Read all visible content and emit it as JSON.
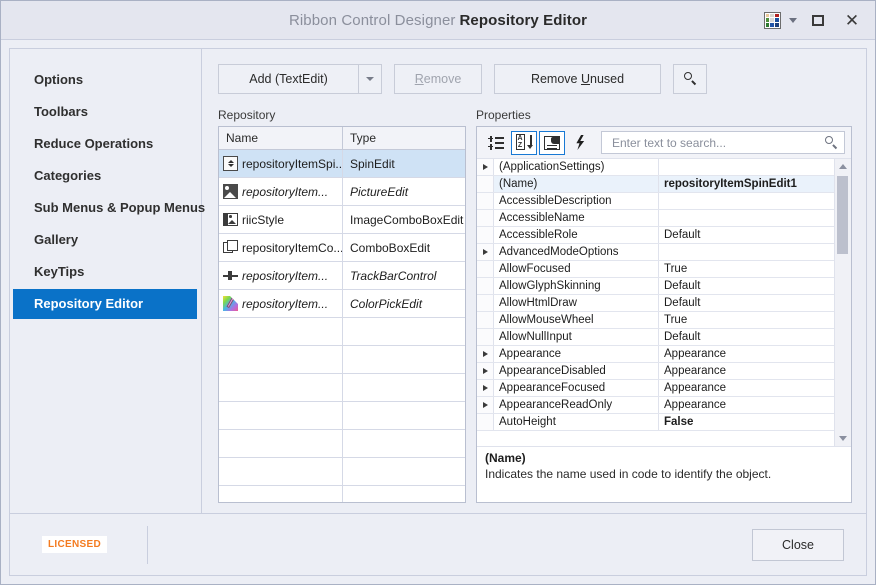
{
  "titlebar": {
    "app_name": "Ribbon Control Designer",
    "page_name": "Repository Editor",
    "skin_icon": "palette-grid-icon",
    "skin_caret_icon": "chevron-down-icon",
    "restore_icon": "restore-window-icon",
    "close_icon": "close-window-icon",
    "palette_colors": [
      "#e8c79a",
      "#d6d6cf",
      "#b02020",
      "#4f8f3d",
      "#d8d8d8",
      "#1b4f9c",
      "#2f7a32",
      "#2255a8",
      "#1c3f7a"
    ]
  },
  "sidebar": {
    "items": [
      {
        "label": "Options",
        "selected": false
      },
      {
        "label": "Toolbars",
        "selected": false
      },
      {
        "label": "Reduce Operations",
        "selected": false
      },
      {
        "label": "Categories",
        "selected": false
      },
      {
        "label": "Sub Menus & Popup Menus",
        "selected": false
      },
      {
        "label": "Gallery",
        "selected": false
      },
      {
        "label": "KeyTips",
        "selected": false
      },
      {
        "label": "Repository Editor",
        "selected": true
      }
    ],
    "selected_color": "#0a72c8"
  },
  "toolbar": {
    "add_label": "Add (TextEdit)",
    "add_dropdown_icon": "chevron-down-icon",
    "remove_label": "Remove",
    "remove_accesskey": "R",
    "remove_enabled": false,
    "remove_unused_label": "Remove Unused",
    "remove_unused_accesskey": "U",
    "search_icon": "search-icon"
  },
  "repository": {
    "label": "Repository",
    "columns": [
      "Name",
      "Type"
    ],
    "rows": [
      {
        "name": "repositoryItemSpi...",
        "type": "SpinEdit",
        "icon": "spin-edit-icon",
        "selected": true,
        "unused": false
      },
      {
        "name": "repositoryItem...",
        "type": "PictureEdit",
        "icon": "picture-edit-icon",
        "selected": false,
        "unused": true
      },
      {
        "name": "riicStyle",
        "type": "ImageComboBoxEdit",
        "icon": "image-combobox-edit-icon",
        "selected": false,
        "unused": false
      },
      {
        "name": "repositoryItemCo...",
        "type": "ComboBoxEdit",
        "icon": "combobox-edit-icon",
        "selected": false,
        "unused": false
      },
      {
        "name": "repositoryItem...",
        "type": "TrackBarControl",
        "icon": "trackbar-control-icon",
        "selected": false,
        "unused": true
      },
      {
        "name": "repositoryItem...",
        "type": "ColorPickEdit",
        "icon": "colorpick-edit-icon",
        "selected": false,
        "unused": true
      }
    ],
    "empty_row_count": 7,
    "selection_color": "#cfe2f5"
  },
  "properties": {
    "label": "Properties",
    "toolbar": {
      "categorized_icon": "categorized-sort-icon",
      "alphabetical_icon": "alphabetical-sort-icon",
      "alphabetical_active": true,
      "properties_icon": "properties-page-icon",
      "properties_active": true,
      "events_icon": "events-lightning-icon",
      "search_placeholder": "Enter text to search...",
      "search_value": "",
      "search_icon": "search-icon"
    },
    "rows": [
      {
        "name": "(ApplicationSettings)",
        "value": "",
        "expandable": true,
        "selected": false,
        "bold": false
      },
      {
        "name": "(Name)",
        "value": "repositoryItemSpinEdit1",
        "expandable": false,
        "selected": true,
        "bold": true
      },
      {
        "name": "AccessibleDescription",
        "value": "",
        "expandable": false,
        "selected": false,
        "bold": false
      },
      {
        "name": "AccessibleName",
        "value": "",
        "expandable": false,
        "selected": false,
        "bold": false
      },
      {
        "name": "AccessibleRole",
        "value": "Default",
        "expandable": false,
        "selected": false,
        "bold": false
      },
      {
        "name": "AdvancedModeOptions",
        "value": "",
        "expandable": true,
        "selected": false,
        "bold": false
      },
      {
        "name": "AllowFocused",
        "value": "True",
        "expandable": false,
        "selected": false,
        "bold": false
      },
      {
        "name": "AllowGlyphSkinning",
        "value": "Default",
        "expandable": false,
        "selected": false,
        "bold": false
      },
      {
        "name": "AllowHtmlDraw",
        "value": "Default",
        "expandable": false,
        "selected": false,
        "bold": false
      },
      {
        "name": "AllowMouseWheel",
        "value": "True",
        "expandable": false,
        "selected": false,
        "bold": false
      },
      {
        "name": "AllowNullInput",
        "value": "Default",
        "expandable": false,
        "selected": false,
        "bold": false
      },
      {
        "name": "Appearance",
        "value": "Appearance",
        "expandable": true,
        "selected": false,
        "bold": false
      },
      {
        "name": "AppearanceDisabled",
        "value": "Appearance",
        "expandable": true,
        "selected": false,
        "bold": false
      },
      {
        "name": "AppearanceFocused",
        "value": "Appearance",
        "expandable": true,
        "selected": false,
        "bold": false
      },
      {
        "name": "AppearanceReadOnly",
        "value": "Appearance",
        "expandable": true,
        "selected": false,
        "bold": false
      },
      {
        "name": "AutoHeight",
        "value": "False",
        "expandable": false,
        "selected": false,
        "bold": true
      }
    ],
    "description": {
      "title": "(Name)",
      "text": "Indicates the name used in code to identify the object."
    },
    "scrollbar": {
      "up_icon": "scroll-up-arrow-icon",
      "down_icon": "scroll-down-arrow-icon"
    }
  },
  "footer": {
    "licensed_badge": "LICENSED",
    "licensed_color": "#f47b20",
    "close_label": "Close"
  }
}
